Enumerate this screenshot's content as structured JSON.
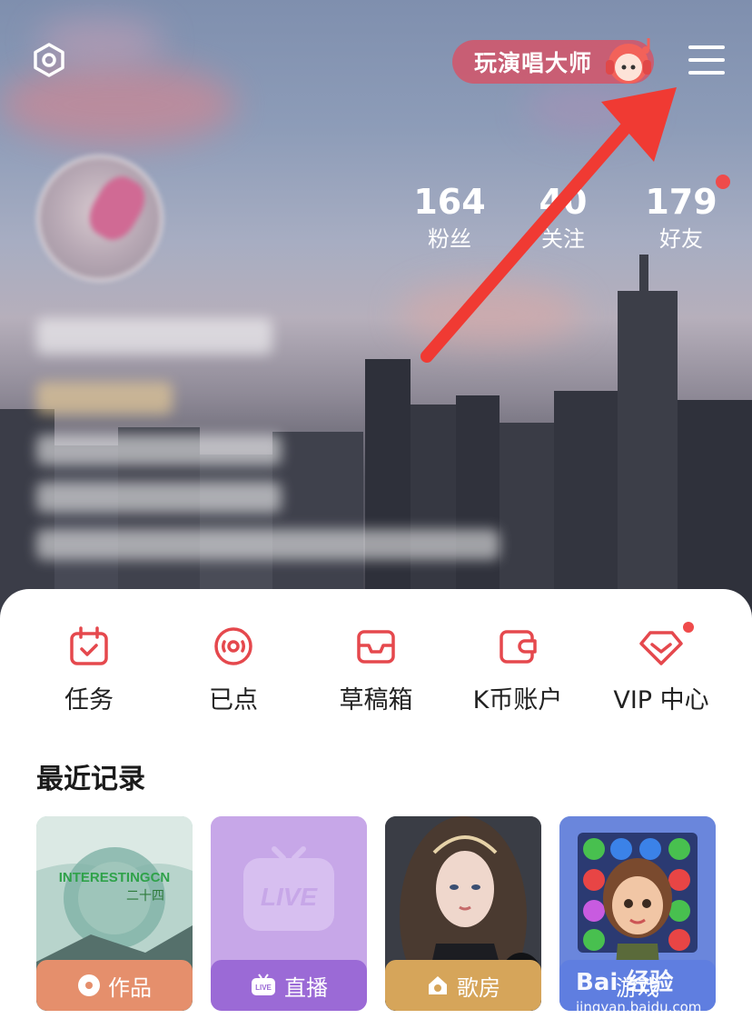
{
  "header": {
    "master_label": "玩演唱大师"
  },
  "stats": [
    {
      "value": "164",
      "label": "粉丝"
    },
    {
      "value": "40",
      "label": "关注"
    },
    {
      "value": "179",
      "label": "好友"
    }
  ],
  "tools": [
    {
      "label": "任务",
      "icon": "calendar-check-icon"
    },
    {
      "label": "已点",
      "icon": "vinyl-disc-icon"
    },
    {
      "label": "草稿箱",
      "icon": "inbox-icon"
    },
    {
      "label": "K币账户",
      "icon": "wallet-icon"
    },
    {
      "label": "VIP 中心",
      "icon": "diamond-heart-icon"
    }
  ],
  "recent": {
    "title": "最近记录",
    "cards": [
      {
        "label": "作品",
        "art_text": "INTERESTINGCN",
        "art_sub": "二十四"
      },
      {
        "label": "直播",
        "art_text": "LIVE"
      },
      {
        "label": "歌房"
      },
      {
        "label": "游戏"
      }
    ]
  },
  "watermark": {
    "line1": "Bai 经验",
    "line2": "jingyan.baidu.com"
  },
  "colors": {
    "accent": "#e5484d",
    "pill": "#d35568",
    "works": "#e58f6c",
    "live": "#9b6ad6",
    "room": "#d6a55a",
    "game": "#5f7ee0"
  }
}
